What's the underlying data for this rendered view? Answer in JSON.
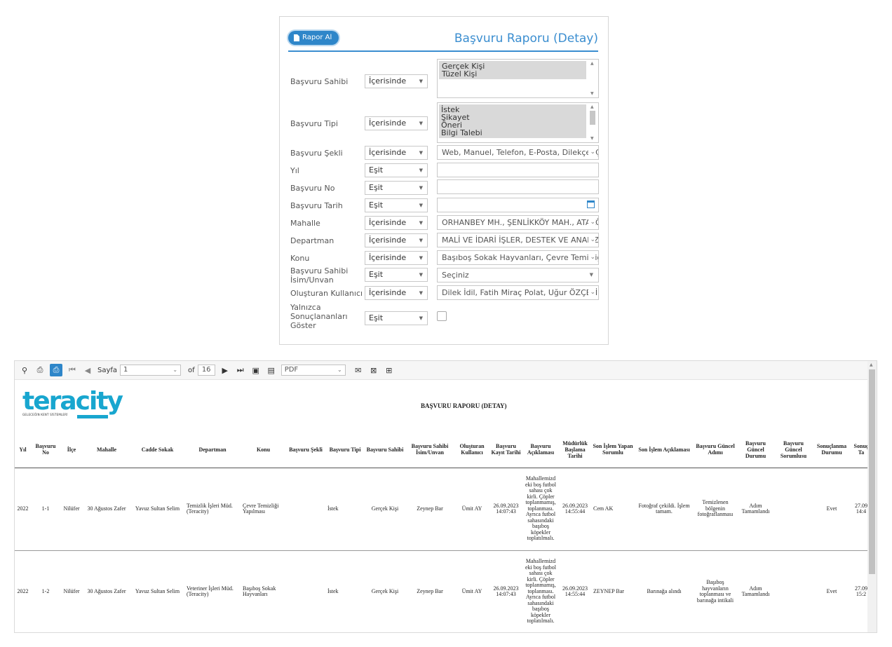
{
  "panel": {
    "button_label": "Rapor Al",
    "title": "Başvuru Raporu (Detay)"
  },
  "filters": {
    "basvuru_sahibi": {
      "label": "Başvuru Sahibi",
      "op": "İçerisinde",
      "options": [
        "Gerçek Kişi",
        "Tüzel Kişi"
      ]
    },
    "basvuru_tipi": {
      "label": "Başvuru Tipi",
      "op": "İçerisinde",
      "options": [
        "İstek",
        "Şikayet",
        "Öneri",
        "Bilgi Talebi"
      ]
    },
    "basvuru_sekli": {
      "label": "Başvuru Şekli",
      "op": "İçerisinde",
      "value": "Web, Manuel, Telefon, E-Posta, Dilekçe, Ç"
    },
    "yil": {
      "label": "Yıl",
      "op": "Eşit",
      "value": ""
    },
    "basvuru_no": {
      "label": "Başvuru No",
      "op": "Eşit",
      "value": ""
    },
    "basvuru_tarih": {
      "label": "Başvuru Tarih",
      "op": "Eşit",
      "value": ""
    },
    "mahalle": {
      "label": "Mahalle",
      "op": "İçerisinde",
      "value": "ORHANBEY MH., ŞENLİKKÖY MAH., ATAKÖ"
    },
    "departman": {
      "label": "Departman",
      "op": "İçerisinde",
      "value": "MALİ VE İDARİ İŞLER, DESTEK VE ANALİZ"
    },
    "konu": {
      "label": "Konu",
      "op": "İçerisinde",
      "value": "Başıboş Sokak Hayvanları, Çevre Temizliği"
    },
    "sahibi_isim": {
      "label": "Başvuru Sahibi İsim/Unvan",
      "op": "Eşit",
      "value": "Seçiniz"
    },
    "olusturan": {
      "label": "Oluşturan Kullanıcı",
      "op": "İçerisinde",
      "value": "Dilek İdil, Fatih Miraç Polat, Uğur ÖZÇELİK"
    },
    "yalnizca": {
      "label": "Yalnızca Sonuçlananları Göster",
      "op": "Eşit"
    }
  },
  "toolbar": {
    "page_label": "Sayfa",
    "page_value": "1",
    "of_label": "of",
    "total_pages": "16",
    "format_value": "PDF"
  },
  "report": {
    "logo_text": "teracity",
    "logo_sub": "GELECEĞİN KENT SİSTEMLERİ",
    "title": "BAŞVURU RAPORU (DETAY)",
    "columns": [
      "Yıl",
      "Başvuru No",
      "İlçe",
      "Mahalle",
      "Cadde Sokak",
      "Departman",
      "Konu",
      "Başvuru Şekli",
      "Başvuru Tipi",
      "Başvuru Sahibi",
      "Başvuru Sahibi İsim/Unvan",
      "Oluşturan Kullanıcı",
      "Başvuru Kayıt Tarihi",
      "Başvuru Açıklaması",
      "Müdürlük Başlama Tarihi",
      "Son İşlem Yapan Sorumlu",
      "Son İşlem Açıklaması",
      "Başvuru Güncel Adımı",
      "Başvuru Güncel Durumu",
      "Başvuru Güncel Sorumlusu",
      "Sonuçlanma Durumu",
      "Sonuç Ta"
    ],
    "rows": [
      [
        "2022",
        "1-1",
        "Nilüfer",
        "30 Ağustos Zafer",
        "Yavuz Sultan Selim",
        "Temizlik İşleri Müd. (Teracity)",
        "Çevre Temizliği Yapılması",
        "",
        "İstek",
        "Gerçek Kişi",
        "Zeynep Bar",
        "Ümit AY",
        "26.09.2023 14:07:43",
        "Mahallemizd eki boş futbol sahası çok kirli. Çöpler toplanmamış, toplanması. Ayrıca futbol sahasındaki başıboş köpekler toplatılmalı.",
        "26.09.2023 14:55:44",
        "Cem AK",
        "Fotoğraf çekildi. İşlem tamam.",
        "Temizlenen bölgenin fotoğraflanması",
        "Adım Tamamlandı",
        "",
        "Evet",
        "27.09 14:4"
      ],
      [
        "2022",
        "1-2",
        "Nilüfer",
        "30 Ağustos Zafer",
        "Yavuz Sultan Selim",
        "Veteriner İşleri Müd. (Teracity)",
        "Başıboş Sokak Hayvanları",
        "",
        "İstek",
        "Gerçek Kişi",
        "Zeynep Bar",
        "Ümit AY",
        "26.09.2023 14:07:43",
        "Mahallemizd eki boş futbol sahası çok kirli. Çöpler toplanmamış, toplanması. Ayrıca futbol sahasındaki başıboş köpekler toplatılmalı.",
        "26.09.2023 14:55:44",
        "ZEYNEP Bar",
        "Barınağa alındı",
        "Başıboş hayvanların toplanması ve barınağa intikali",
        "Adım Tamamlandı",
        "",
        "Evet",
        "27.09 15:2"
      ]
    ]
  }
}
